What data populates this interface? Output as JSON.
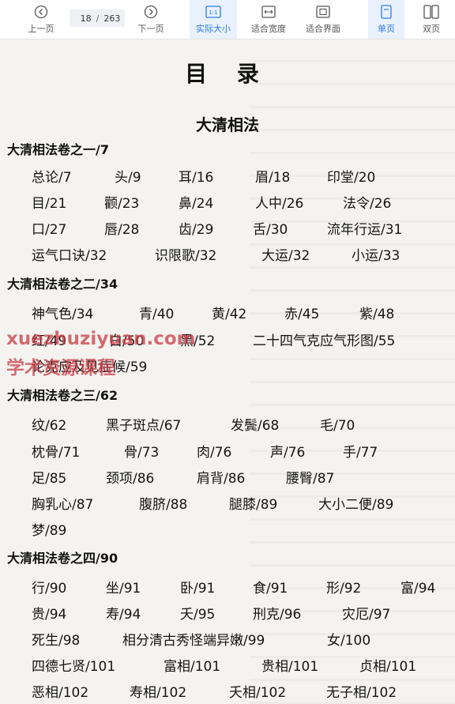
{
  "toolbar": {
    "prev_label": "上一页",
    "next_label": "下一页",
    "current_page": "18",
    "separator": "/",
    "total_pages": "263",
    "actual_size_label": "实际大小",
    "actual_size_icon_text": "1:1",
    "fit_width_label": "适合宽度",
    "fit_page_label": "适合界面",
    "single_page_label": "单页",
    "double_page_label": "双页",
    "accent_color": "#2f7de1"
  },
  "page": {
    "title": "目 录",
    "subtitle": "大清相法",
    "sections": [
      {
        "heading": "大清相法卷之一/7",
        "rows": [
          [
            "总论/7",
            "头/9",
            "耳/16",
            "眉/18",
            "印堂/20"
          ],
          [
            "目/21",
            "颧/23",
            "鼻/24",
            "人中/26",
            "法令/26"
          ],
          [
            "口/27",
            "唇/28",
            "齿/29",
            "舌/30",
            "流年行运/31"
          ],
          [
            "运气口诀/32",
            "识限歌/32",
            "大运/32",
            "小运/33"
          ]
        ]
      },
      {
        "heading": "大清相法卷之二/34",
        "rows": [
          [
            "神气色/34",
            "青/40",
            "黄/42",
            "赤/45",
            "紫/48"
          ],
          [
            "红/49",
            "白/50",
            "黑/52",
            "二十四气克应气形图/55"
          ],
          [
            "论克应及见症候/59"
          ]
        ]
      },
      {
        "heading": "大清相法卷之三/62",
        "rows": [
          [
            "纹/62",
            "黑子斑点/67",
            "发鬓/68",
            "毛/70"
          ],
          [
            "枕骨/71",
            "骨/73",
            "肉/76",
            "声/76",
            "手/77"
          ],
          [
            "足/85",
            "颈项/86",
            "肩背/86",
            "腰臀/87"
          ],
          [
            "胸乳心/87",
            "腹脐/88",
            "腿膝/89",
            "大小二便/89"
          ],
          [
            "梦/89"
          ]
        ]
      },
      {
        "heading": "大清相法卷之四/90",
        "rows": [
          [
            "行/90",
            "坐/91",
            "卧/91",
            "食/91",
            "形/92",
            "富/94"
          ],
          [
            "贵/94",
            "寿/94",
            "夭/95",
            "刑克/96",
            "灾厄/97"
          ],
          [
            "死生/98",
            "相分清古秀怪端异嫩/99",
            "女/100"
          ],
          [
            "四德七贤/101",
            "富相/101",
            "贵相/101",
            "贞相/101"
          ],
          [
            "恶相/102",
            "寿相/102",
            "夭相/102",
            "无子相/102"
          ]
        ]
      }
    ],
    "watermark_line1": "xuezhuziyuan.com",
    "watermark_line2": "学术资源课程",
    "watermark_color": "#c83c46"
  }
}
